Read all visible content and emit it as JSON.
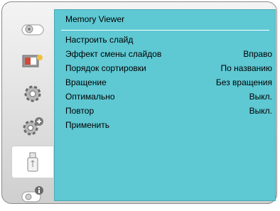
{
  "sidebar": {
    "items": [
      {
        "icon": "projector-icon"
      },
      {
        "icon": "picture-settings-icon"
      },
      {
        "icon": "gear-icon"
      },
      {
        "icon": "gear-plus-icon"
      },
      {
        "icon": "usb-stick-icon",
        "active": true
      },
      {
        "icon": "projector-info-icon"
      }
    ]
  },
  "panel": {
    "title": "Memory Viewer",
    "rows": [
      {
        "label": "Настроить слайд",
        "value": ""
      },
      {
        "label": "Эффект смены слайдов",
        "value": "Вправо"
      },
      {
        "label": "Порядок сортировки",
        "value": "По названию"
      },
      {
        "label": "Вращение",
        "value": "Без вращения"
      },
      {
        "label": "Оптимально",
        "value": "Выкл."
      },
      {
        "label": "Повтор",
        "value": "Выкл."
      },
      {
        "label": "Применить",
        "value": ""
      }
    ]
  },
  "colors": {
    "panel": "#5ec8d3",
    "frame": "#e2e2e2"
  }
}
